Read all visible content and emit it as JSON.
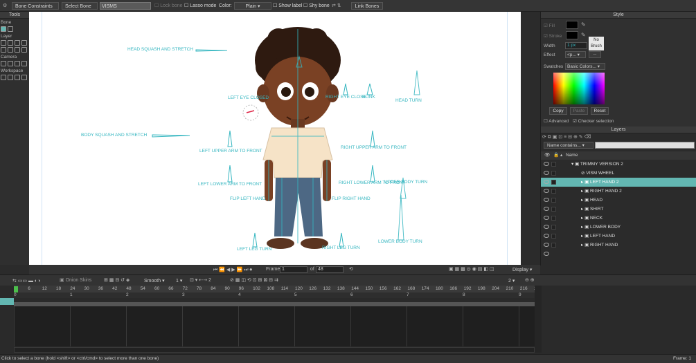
{
  "toolbar": {
    "constraints": "Bone Constraints",
    "select_bone": "Select Bone",
    "bone_name": "VISMS",
    "lock_bone": "Lock bone",
    "lasso": "Lasso mode",
    "color_label": "Color:",
    "color_value": "Plain",
    "show_label": "Show label",
    "shy_bone": "Shy bone",
    "link_bones": "Link Bones"
  },
  "tools": {
    "title": "Tools",
    "bone": "Bone",
    "layer": "Layer",
    "camera": "Camera",
    "workspace": "Workspace"
  },
  "canvas": {
    "labels": [
      "HEAD SQUASH AND STRETCH",
      "LEFT EYE CLOSED",
      "RIGHT EYE CLOSE",
      "BLINK",
      "HEAD TURN",
      "BODY SQUASH AND STRETCH",
      "LEFT UPPER ARM TO FRONT",
      "RIGHT UPPER ARM TO FRONT",
      "LEFT LOWER ARM TO FRONT",
      "RIGHT LOWER ARM TO FRONT",
      "UPPER BODY TURN",
      "FLIP LEFT HAND",
      "FLIP RIGHT HAND",
      "LOWER BODY TURN",
      "LEFT LEG TURN",
      "RIGHT LEG TURN"
    ]
  },
  "frame_bar": {
    "frame_label": "Frame",
    "frame": "1",
    "of_label": "of",
    "total": "48",
    "display": "Display"
  },
  "style": {
    "title": "Style",
    "fill": "Fill",
    "stroke": "Stroke",
    "width_label": "Width",
    "width_value": "1 px",
    "effect_label": "Effect",
    "effect_value": "<p...",
    "no_brush": "No Brush",
    "swatches_label": "Swatches",
    "swatches_value": "Basic Colors...",
    "copy": "Copy",
    "paste": "Paste",
    "reset": "Reset",
    "advanced": "Advanced",
    "checker": "Checker selection"
  },
  "layers": {
    "title": "Layers",
    "filter": "Name contains...",
    "name_col": "Name",
    "items": [
      {
        "name": "TRIMMY VERSION  2",
        "indent": 0
      },
      {
        "name": "VISM WHEEL",
        "indent": 1
      },
      {
        "name": "LEFT HAND 2",
        "indent": 1
      },
      {
        "name": "RIGHT HAND 2",
        "indent": 1
      },
      {
        "name": "HEAD",
        "indent": 1
      },
      {
        "name": "SHIRT",
        "indent": 1
      },
      {
        "name": "NECK",
        "indent": 1
      },
      {
        "name": "LOWER BODY",
        "indent": 1
      },
      {
        "name": "LEFT HAND",
        "indent": 1
      },
      {
        "name": "RIGHT HAND",
        "indent": 1
      }
    ]
  },
  "timeline": {
    "onion": "Onion Skins",
    "smooth": "Smooth",
    "smooth_val": "1",
    "step": "2",
    "right_val": "2",
    "ruler": [
      "0",
      "6",
      "12",
      "18",
      "24",
      "30",
      "36",
      "42",
      "48",
      "54",
      "60",
      "66",
      "72",
      "78",
      "84",
      "90",
      "96",
      "102",
      "108",
      "114",
      "120",
      "126",
      "132",
      "138",
      "144",
      "150",
      "156",
      "162",
      "168",
      "174",
      "180",
      "186",
      "192",
      "198",
      "204",
      "210",
      "216",
      "22"
    ],
    "seconds": [
      "0",
      "1",
      "2",
      "3",
      "4",
      "5",
      "6",
      "7",
      "8",
      "9"
    ]
  },
  "status": {
    "text": "Click to select a bone (hold <shift> or <ctrl/cmd> to select more than one bone)",
    "frame": "Frame: 1"
  },
  "colors": {
    "accent": "#35b6c0",
    "selected_row": "#63b7b2",
    "canvas": "#ffffff"
  }
}
